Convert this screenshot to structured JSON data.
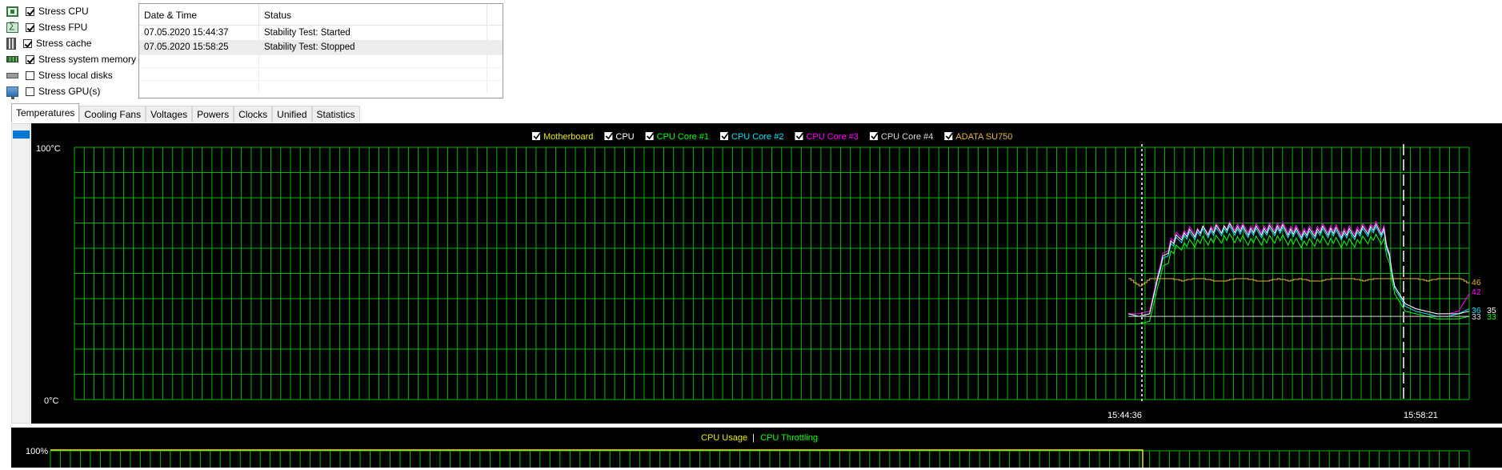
{
  "stress": [
    {
      "label": "Stress CPU",
      "checked": true,
      "icon": "cpu-icon"
    },
    {
      "label": "Stress FPU",
      "checked": true,
      "icon": "fpu-icon"
    },
    {
      "label": "Stress cache",
      "checked": true,
      "icon": "cache-icon"
    },
    {
      "label": "Stress system memory",
      "checked": true,
      "icon": "memory-icon"
    },
    {
      "label": "Stress local disks",
      "checked": false,
      "icon": "disk-icon"
    },
    {
      "label": "Stress GPU(s)",
      "checked": false,
      "icon": "gpu-icon"
    }
  ],
  "events": {
    "headers": [
      "Date & Time",
      "Status"
    ],
    "rows": [
      {
        "time": "07.05.2020 15:44:37",
        "status": "Stability Test: Started"
      },
      {
        "time": "07.05.2020 15:58:25",
        "status": "Stability Test: Stopped"
      }
    ]
  },
  "tabs": [
    "Temperatures",
    "Cooling Fans",
    "Voltages",
    "Powers",
    "Clocks",
    "Unified",
    "Statistics"
  ],
  "active_tab": "Temperatures",
  "colors": {
    "grid": "#00b400",
    "motherboard": "#e8e800",
    "cpu": "#ffffff",
    "core1": "#00ff00",
    "core2": "#00e5ff",
    "core3": "#ff00ff",
    "core4": "#d9d9d9",
    "ssd": "#e6b43c",
    "usage": "#e8e800",
    "throttling": "#00ff00"
  },
  "chart_data": [
    {
      "type": "line",
      "legend": [
        {
          "name": "Motherboard",
          "color": "#e8e800"
        },
        {
          "name": "CPU",
          "color": "#ffffff"
        },
        {
          "name": "CPU Core #1",
          "color": "#00ff00"
        },
        {
          "name": "CPU Core #2",
          "color": "#00e5ff"
        },
        {
          "name": "CPU Core #3",
          "color": "#ff00ff"
        },
        {
          "name": "CPU Core #4",
          "color": "#d9d9d9"
        },
        {
          "name": "ADATA SU750",
          "color": "#e6b43c"
        }
      ],
      "ylim": [
        0,
        100
      ],
      "y_tick_labels": [
        "100°C",
        "0°C"
      ],
      "markers": [
        "15:44:36",
        "15:58:21"
      ],
      "end_values": [
        {
          "value": "46",
          "color": "#e6b43c"
        },
        {
          "value": "42",
          "color": "#ff00ff"
        },
        {
          "value": "36",
          "color": "#00e5ff"
        },
        {
          "value": "35",
          "color": "#ffffff"
        },
        {
          "value": "33",
          "color": "#d9d9d9"
        },
        {
          "value": "33",
          "color": "#00ff00"
        }
      ],
      "series": [
        {
          "name": "CPU Core #3",
          "color": "#ff00ff",
          "values": [
            34,
            34,
            35,
            54,
            63,
            66,
            67,
            67,
            68,
            68,
            69,
            68,
            68,
            68,
            69,
            68,
            67,
            67,
            68,
            68,
            67,
            67,
            68,
            69,
            68,
            45,
            38,
            36,
            35,
            34,
            34,
            35,
            42
          ]
        },
        {
          "name": "CPU Core #2",
          "color": "#00e5ff",
          "values": [
            34,
            33,
            34,
            52,
            61,
            64,
            65,
            66,
            66,
            67,
            67,
            66,
            66,
            66,
            67,
            66,
            65,
            65,
            66,
            66,
            65,
            65,
            66,
            67,
            66,
            44,
            37,
            35,
            34,
            33,
            33,
            34,
            36
          ]
        },
        {
          "name": "CPU",
          "color": "#ffffff",
          "values": [
            34,
            33,
            34,
            53,
            62,
            65,
            66,
            67,
            67,
            68,
            68,
            67,
            67,
            67,
            68,
            67,
            66,
            66,
            67,
            67,
            66,
            66,
            67,
            68,
            67,
            45,
            38,
            36,
            35,
            34,
            34,
            34,
            35
          ]
        },
        {
          "name": "CPU Core #1",
          "color": "#00ff00",
          "values": [
            30,
            30,
            31,
            49,
            58,
            61,
            62,
            63,
            63,
            64,
            64,
            63,
            63,
            63,
            64,
            63,
            62,
            62,
            63,
            63,
            62,
            62,
            63,
            64,
            63,
            42,
            35,
            34,
            33,
            32,
            32,
            32,
            33
          ]
        },
        {
          "name": "CPU Core #4",
          "color": "#d9d9d9",
          "values": [
            33,
            33,
            33,
            33,
            33,
            33,
            33,
            33,
            33,
            33,
            33,
            33,
            33,
            33,
            33,
            33,
            33,
            33,
            33,
            33,
            33,
            33,
            33,
            33,
            33,
            33,
            33,
            33,
            33,
            33,
            33,
            33,
            33
          ]
        },
        {
          "name": "ADATA SU750",
          "color": "#e6b43c",
          "values": [
            48,
            45,
            48,
            48,
            48,
            47,
            48,
            48,
            47,
            47,
            48,
            48,
            47,
            47,
            48,
            47,
            48,
            47,
            47,
            48,
            48,
            48,
            47,
            48,
            48,
            48,
            48,
            48,
            47,
            48,
            48,
            48,
            46
          ]
        }
      ]
    },
    {
      "type": "line",
      "legend": [
        {
          "name": "CPU Usage",
          "color": "#e8e800"
        },
        {
          "name": "CPU Throttling",
          "color": "#00ff00"
        }
      ],
      "separator": "|",
      "y_tick_labels": [
        "100%"
      ],
      "ylim": [
        0,
        100
      ],
      "series": [
        {
          "name": "CPU Usage",
          "color": "#e8e800",
          "values": [
            100,
            100
          ]
        }
      ]
    }
  ]
}
